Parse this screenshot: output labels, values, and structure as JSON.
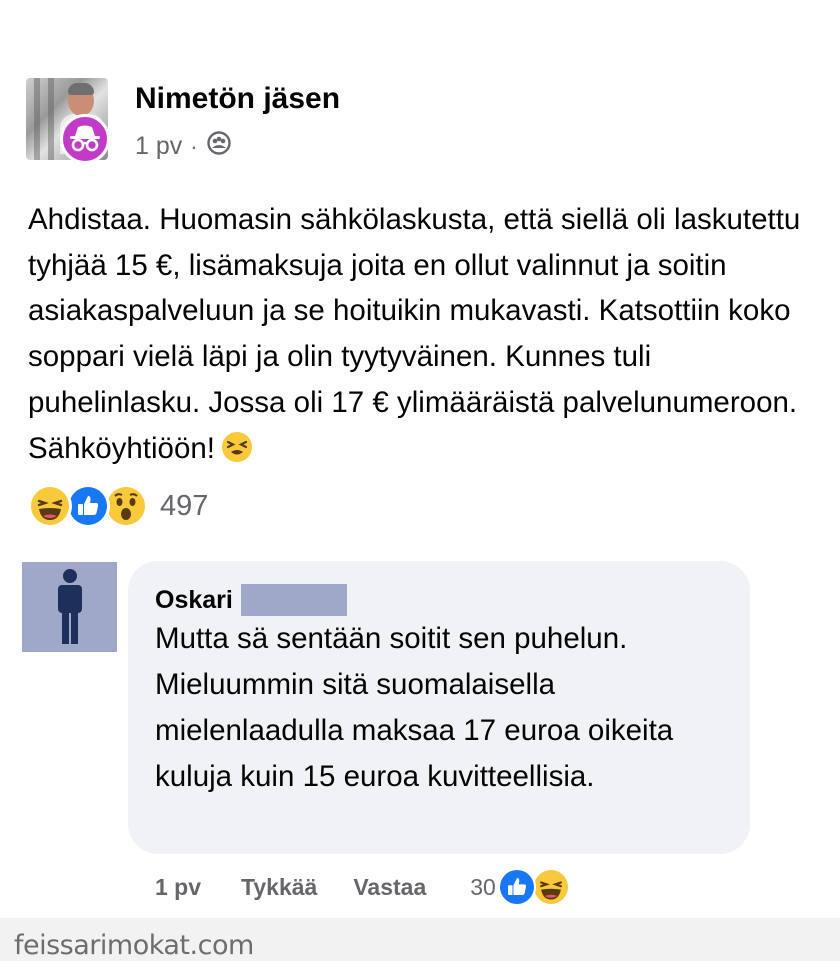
{
  "post": {
    "author": "Nimetön jäsen",
    "time": "1 pv",
    "separator": "·",
    "audience_icon": "group-icon",
    "text": "Ahdistaa. Huomasin sähkölaskusta, että siellä oli laskutettu tyhjää 15 €, lisämaksuja joita en ollut valinnut ja soitin asiakaspalveluun ja se hoituikin mukavasti. Katsottiin koko soppari vielä läpi ja olin tyytyväinen. Kunnes tuli puhelinlasku. Jossa oli 17 € ylimääräistä palvelunumeroon. Sähköyhtiöön!",
    "text_emoji": "tired-face-emoji",
    "reactions": [
      "haha",
      "like",
      "wow"
    ],
    "reaction_count": "497"
  },
  "comment": {
    "author": "Oskari",
    "text": "Mutta sä sentään soitit sen puhelun. Mieluummin sitä suomalaisella mielenlaadulla maksaa 17 euroa oikeita kuluja kuin 15 euroa kuvitteellisia.",
    "time": "1 pv",
    "like_label": "Tykkää",
    "reply_label": "Vastaa",
    "reaction_count": "30",
    "reactions": [
      "like",
      "haha"
    ]
  },
  "watermark": "feissarimokat.com",
  "colors": {
    "anon_badge": "#c23bc8",
    "like_blue": "#1877f2",
    "emoji_yellow": "#f7c93b",
    "bubble": "#f0f2f5",
    "placeholder_avatar": "#9fa8c9",
    "secondary_text": "#65676b"
  }
}
